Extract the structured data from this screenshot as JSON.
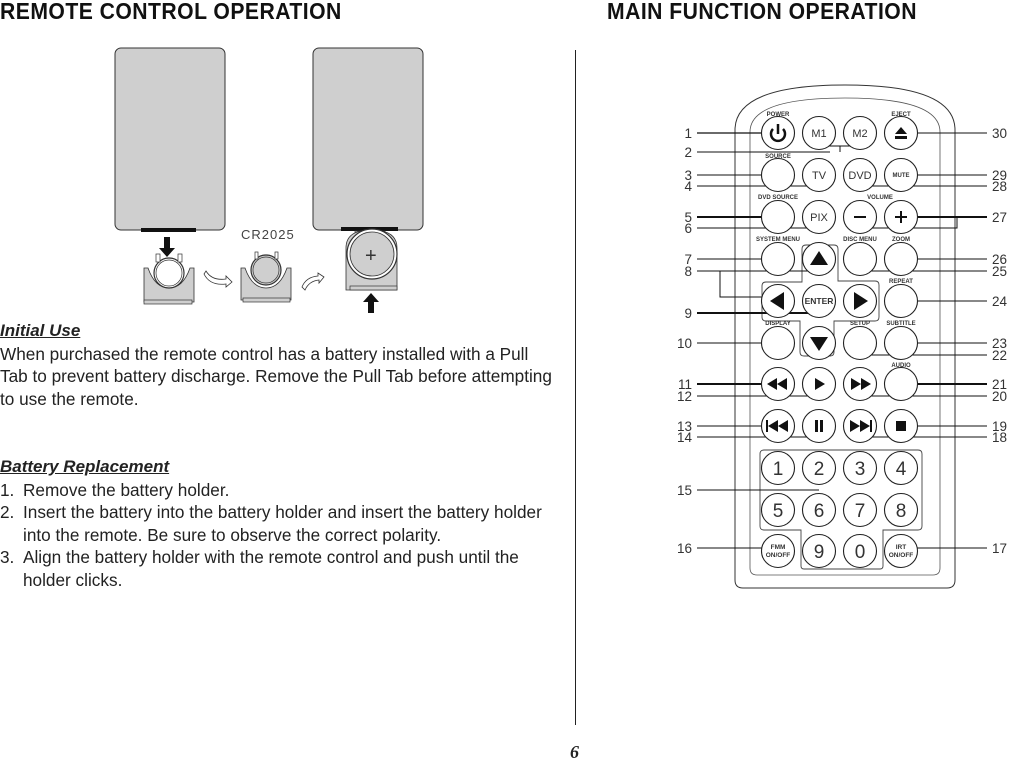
{
  "page": {
    "left_title": "REMOTE CONTROL OPERATION",
    "right_title": "MAIN FUNCTION OPERATION",
    "page_number": "6"
  },
  "battery_figure": {
    "battery_label": "CR2025",
    "plus_symbol": "+"
  },
  "initial_use": {
    "heading": "Initial Use",
    "body": "When purchased the remote control has a battery installed with a Pull Tab to prevent battery discharge. Remove the Pull Tab before attempting to use the remote."
  },
  "battery_replacement": {
    "heading": "Battery Replacement",
    "steps": [
      {
        "num": "1.",
        "text": "Remove the battery holder."
      },
      {
        "num": "2.",
        "text": "Insert the battery into the battery holder and insert the battery holder into the remote. Be sure to observe the correct polarity."
      },
      {
        "num": "3.",
        "text": "Align the battery holder with the remote control and push until the holder clicks."
      }
    ]
  },
  "remote": {
    "labels": {
      "power": "POWER",
      "eject": "EJECT",
      "source": "SOURCE",
      "dvd_source": "DVD SOURCE",
      "volume": "VOLUME",
      "system_menu": "SYSTEM MENU",
      "disc_menu": "DISC MENU",
      "zoom": "ZOOM",
      "repeat": "REPEAT",
      "display": "DISPLAY",
      "setup": "SETUP",
      "subtitle": "SUBTITLE",
      "audio": "AUDIO"
    },
    "buttons": {
      "m1": "M1",
      "m2": "M2",
      "tv": "TV",
      "dvd": "DVD",
      "mute": "MUTE",
      "pix": "PIX",
      "enter": "ENTER",
      "fmm_1": "FMM",
      "fmm_2": "ON/OFF",
      "irt_1": "IRT",
      "irt_2": "ON/OFF",
      "digits": [
        "1",
        "2",
        "3",
        "4",
        "5",
        "6",
        "7",
        "8",
        "9",
        "0"
      ]
    },
    "callouts_left": [
      "1",
      "2",
      "3",
      "4",
      "5",
      "6",
      "7",
      "8",
      "9",
      "10",
      "11",
      "12",
      "13",
      "14",
      "15",
      "16"
    ],
    "callouts_right": [
      "30",
      "29",
      "28",
      "27",
      "26",
      "25",
      "24",
      "23",
      "22",
      "21",
      "20",
      "19",
      "18",
      "17"
    ]
  }
}
